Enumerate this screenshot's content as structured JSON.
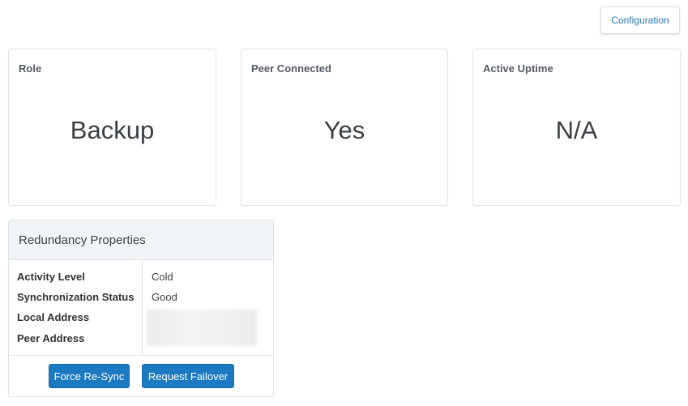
{
  "toolbar": {
    "configuration_label": "Configuration"
  },
  "cards": [
    {
      "title": "Role",
      "value": "Backup"
    },
    {
      "title": "Peer Connected",
      "value": "Yes"
    },
    {
      "title": "Active Uptime",
      "value": "N/A"
    }
  ],
  "redundancy": {
    "title": "Redundancy Properties",
    "properties": [
      {
        "label": "Activity Level",
        "value": "Cold"
      },
      {
        "label": "Synchronization Status",
        "value": "Good"
      },
      {
        "label": "Local Address",
        "value": ""
      },
      {
        "label": "Peer Address",
        "value": ""
      }
    ],
    "actions": {
      "force_resync_label": "Force Re-Sync",
      "request_failover_label": "Request Failover"
    }
  },
  "colors": {
    "primary_button": "#1b7ac2",
    "link_text": "#2a7ab8",
    "panel_header_bg": "#f1f4f7"
  }
}
